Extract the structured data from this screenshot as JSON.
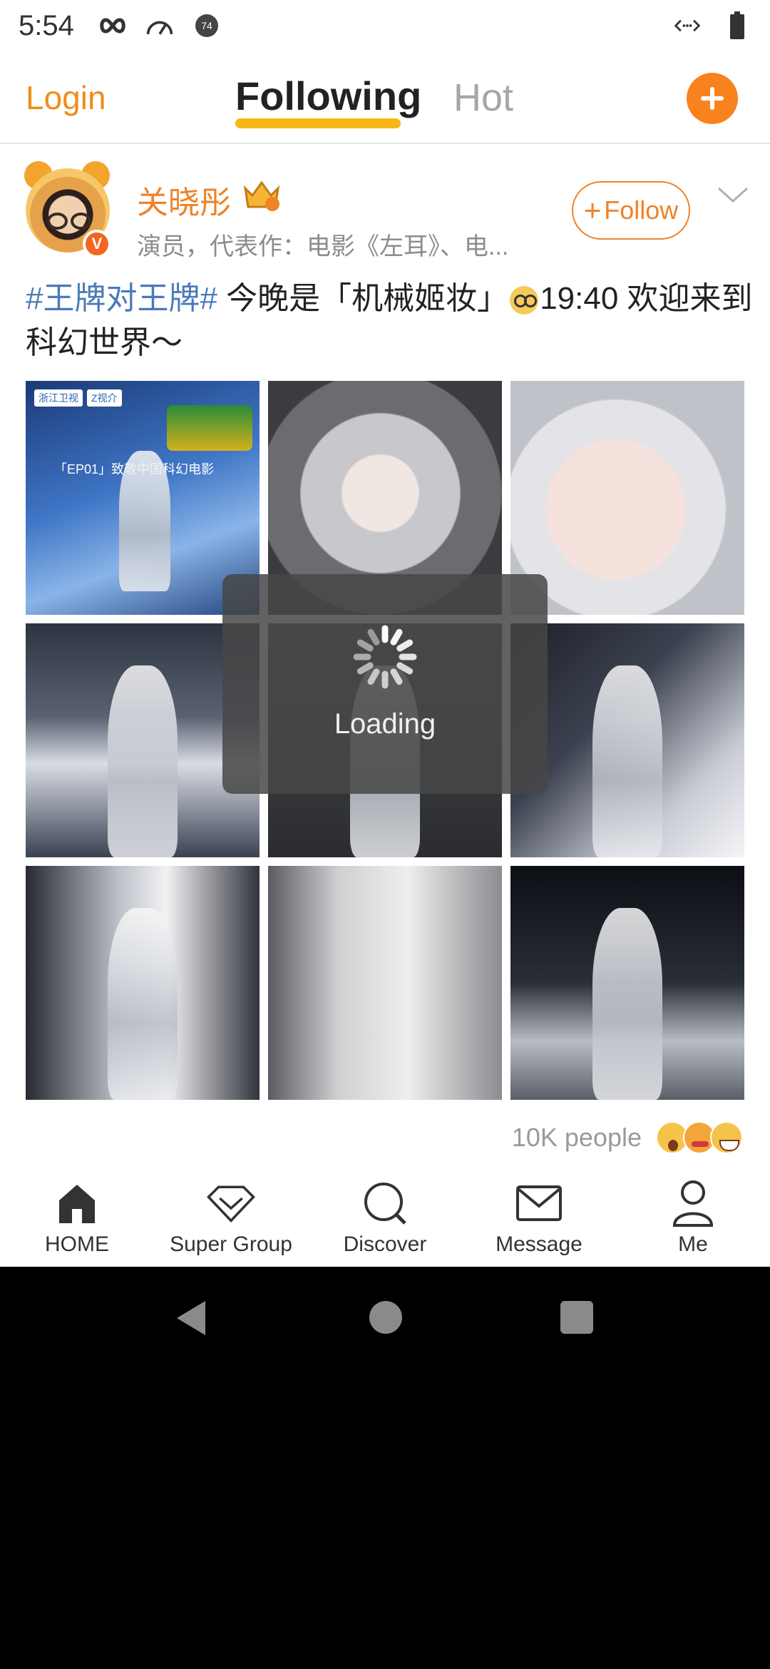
{
  "status_bar": {
    "time": "5:54",
    "left_icons": [
      "infinity-icon",
      "speedometer-icon",
      "notification-74-icon"
    ],
    "notification_count": "74",
    "right_icons": [
      "data-transfer-icon",
      "battery-icon"
    ]
  },
  "top_nav": {
    "login_label": "Login",
    "tabs": [
      {
        "label": "Following",
        "active": true
      },
      {
        "label": "Hot",
        "active": false
      }
    ],
    "compose_icon": "plus-icon",
    "accent_color": "#f08228"
  },
  "post": {
    "user_name": "关晓彤",
    "verified_badge": "V",
    "user_description": "演员，代表作：电影《左耳》、电...",
    "follow_label": "Follow",
    "hashtag": "#王牌对王牌#",
    "text_part1": " 今晚是「机械姬妆」",
    "text_part2": "19:40 欢迎来到科幻世界～",
    "photo_count": 9,
    "photo1": {
      "tags": [
        "浙江卫视",
        "Z视介"
      ],
      "headline": "「EP01」致敬中国科幻电影"
    },
    "likes_text": "10K people",
    "reactions": [
      "surprised-emoji",
      "kiss-emoji",
      "grin-emoji"
    ]
  },
  "loading": {
    "label": "Loading"
  },
  "bottom_nav": {
    "items": [
      {
        "label": "HOME",
        "icon": "home-icon"
      },
      {
        "label": "Super Group",
        "icon": "diamond-icon"
      },
      {
        "label": "Discover",
        "icon": "search-icon"
      },
      {
        "label": "Message",
        "icon": "envelope-icon"
      },
      {
        "label": "Me",
        "icon": "person-icon"
      }
    ]
  }
}
